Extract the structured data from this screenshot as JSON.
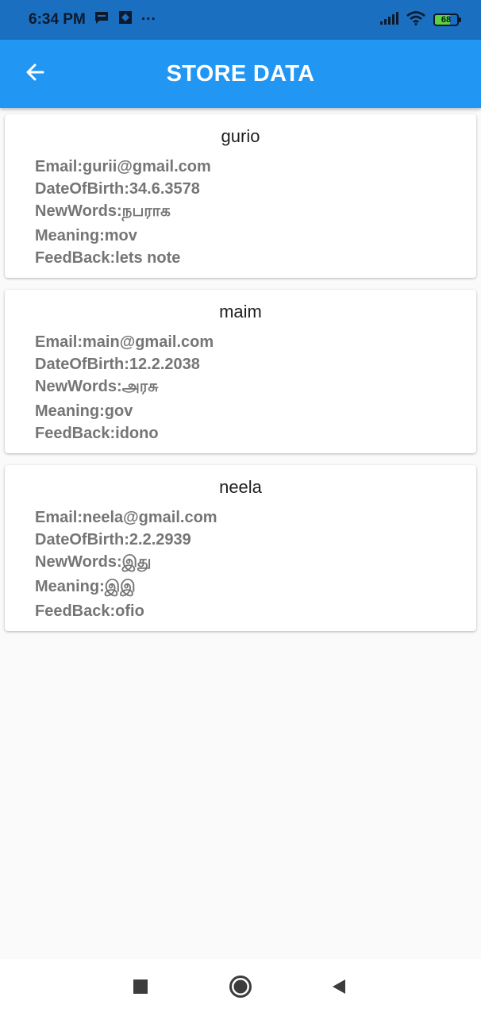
{
  "status_bar": {
    "time": "6:34 PM",
    "notification_icons": [
      "message-icon",
      "app-icon"
    ],
    "more": "···",
    "battery_level": "68",
    "battery_fraction": 0.68
  },
  "app_bar": {
    "title": "STORE DATA",
    "color": "#2196f3"
  },
  "records": [
    {
      "name": "gurio",
      "email_label": "Email:gurii@gmail.com",
      "dob_label": "DateOfBirth:34.6.3578",
      "newwords_label": "NewWords:நபராக",
      "meaning_label": "Meaning:mov",
      "feedback_label": "FeedBack:lets note"
    },
    {
      "name": "maim",
      "email_label": "Email:main@gmail.com",
      "dob_label": "DateOfBirth:12.2.2038",
      "newwords_label": "NewWords:அரசு",
      "meaning_label": "Meaning:gov",
      "feedback_label": "FeedBack:idono"
    },
    {
      "name": "neela",
      "email_label": "Email:neela@gmail.com",
      "dob_label": "DateOfBirth:2.2.2939",
      "newwords_label": "NewWords:இது",
      "meaning_label": "Meaning:இஇ",
      "feedback_label": "FeedBack:ofio"
    }
  ],
  "nav_bar": {
    "buttons": [
      "recents-square-icon",
      "home-circle-icon",
      "back-triangle-icon"
    ]
  }
}
